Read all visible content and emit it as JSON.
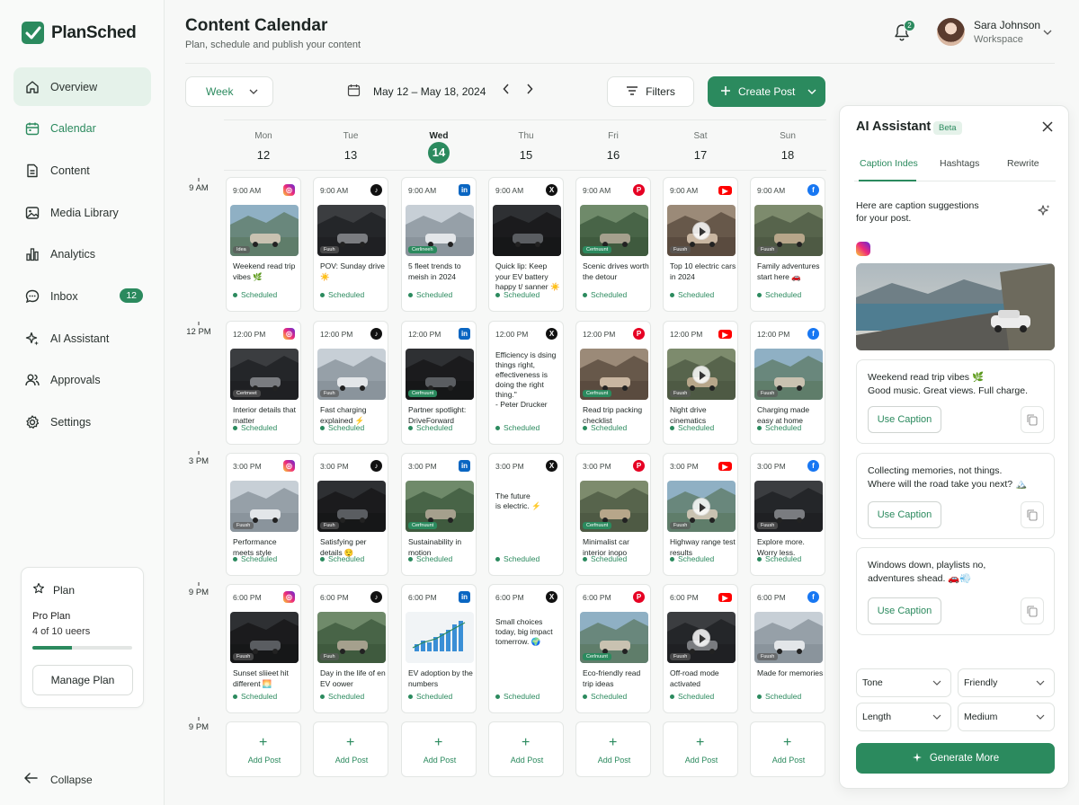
{
  "app": {
    "name": "PlanSched"
  },
  "nav": [
    {
      "label": "Overview",
      "icon": "home-icon"
    },
    {
      "label": "Calendar",
      "icon": "calendar-icon"
    },
    {
      "label": "Content",
      "icon": "document-icon"
    },
    {
      "label": "Media Library",
      "icon": "image-icon"
    },
    {
      "label": "Analytics",
      "icon": "bar-chart-icon"
    },
    {
      "label": "Inbox",
      "icon": "chat-icon",
      "badge": "12"
    },
    {
      "label": "AI Assistant",
      "icon": "sparkle-icon"
    },
    {
      "label": "Approvals",
      "icon": "users-icon"
    },
    {
      "label": "Settings",
      "icon": "gear-icon"
    }
  ],
  "plan": {
    "heading": "Plan",
    "name": "Pro Plan",
    "users": "4 of 10 ueers",
    "usage_fraction": 0.4,
    "button": "Manage Plan"
  },
  "collapse": "Collapse",
  "header": {
    "title": "Content Calendar",
    "subtitle": "Plan, schedule and publish your content",
    "notif_count": "2",
    "user_name": "Sara Johnson",
    "user_workspace": "Workspace"
  },
  "toolbar": {
    "view": "Week",
    "date_range": "May 12 – May 18, 2024",
    "filters": "Filters",
    "create": "Create Post"
  },
  "days": [
    {
      "name": "Mon",
      "num": "12"
    },
    {
      "name": "Tue",
      "num": "13"
    },
    {
      "name": "Wed",
      "num": "14",
      "today": true
    },
    {
      "name": "Thu",
      "num": "15"
    },
    {
      "name": "Fri",
      "num": "16"
    },
    {
      "name": "Sat",
      "num": "17"
    },
    {
      "name": "Sun",
      "num": "18"
    }
  ],
  "times": [
    "9 AM",
    "12 PM",
    "3 PM",
    "9 PM",
    "9 PM"
  ],
  "status_label": "Scheduled",
  "add_label": "Add Post",
  "slots": [
    {
      "time": "9:00 AM",
      "cards": [
        {
          "platform": "instagram",
          "title": "Weekend read trip vibes 🌿",
          "tag": "Idea",
          "tag_green": false
        },
        {
          "platform": "tiktok",
          "title": "POV: Sunday drive ☀️",
          "tag": "Fuuh",
          "tag_green": false
        },
        {
          "platform": "linkedin",
          "title": "5 fleet trends to meish in 2024",
          "tag": "Cerlineeh",
          "tag_green": true
        },
        {
          "platform": "x",
          "title": "Quick lip: Keep your EV battery happy t/ sanner ☀️",
          "tag": "",
          "tag_green": false
        },
        {
          "platform": "pinterest",
          "title": "Scenic drives worth the detour",
          "tag": "Certnuunt",
          "tag_green": true
        },
        {
          "platform": "youtube",
          "title": "Top 10 electric cars in 2024",
          "tag": "Fuush",
          "tag_green": false,
          "video": true
        },
        {
          "platform": "facebook",
          "title": "Family adventures start here 🚗",
          "tag": "Fuush",
          "tag_green": false
        }
      ]
    },
    {
      "time": "12:00 PM",
      "cards": [
        {
          "platform": "instagram",
          "title": "Interior details that matter",
          "tag": "Certmeet",
          "tag_green": false
        },
        {
          "platform": "tiktok",
          "title": "Fast charging explained ⚡",
          "tag": "Fuuh",
          "tag_green": false
        },
        {
          "platform": "linkedin",
          "title": "Partner spotlight: DriveForward",
          "tag": "Cerfnuunt",
          "tag_green": true
        },
        {
          "platform": "x",
          "quote": "Efficiency is dsing things right, effectiveness is doing the right thing.\"\n- Peter Drucker"
        },
        {
          "platform": "pinterest",
          "title": "Read trip packing checklist",
          "tag": "Cerfnuunt",
          "tag_green": true
        },
        {
          "platform": "youtube",
          "title": "Night drive cinematics",
          "tag": "Fuush",
          "tag_green": false,
          "video": true
        },
        {
          "platform": "facebook",
          "title": "Charging made easy at home",
          "tag": "Fuush",
          "tag_green": false
        }
      ]
    },
    {
      "time": "3:00 PM",
      "cards": [
        {
          "platform": "instagram",
          "title": "Performance meets style",
          "tag": "Fuush",
          "tag_green": false
        },
        {
          "platform": "tiktok",
          "title": "Satisfying per details 😌",
          "tag": "Fuuh",
          "tag_green": false
        },
        {
          "platform": "linkedin",
          "title": "Sustainability in motion",
          "tag": "Cerfnuunt",
          "tag_green": true
        },
        {
          "platform": "x",
          "quote": "The future\nis electric. ⚡"
        },
        {
          "platform": "pinterest",
          "title": "Minimalist car interior inopo",
          "tag": "Cerfnuunt",
          "tag_green": true
        },
        {
          "platform": "youtube",
          "title": "Highway range test results",
          "tag": "Fuush",
          "tag_green": false,
          "video": true
        },
        {
          "platform": "facebook",
          "title": "Explore more. Worry less.",
          "tag": "Fuush",
          "tag_green": false
        }
      ]
    },
    {
      "time": "6:00 PM",
      "cards": [
        {
          "platform": "instagram",
          "title": "Sunset sliieet hit different 🌅",
          "tag": "Fuush",
          "tag_green": false
        },
        {
          "platform": "tiktok",
          "title": "Day in the life of en EV oower",
          "tag": "Fuuh",
          "tag_green": false
        },
        {
          "platform": "linkedin",
          "title": "EV adoption by the numbers",
          "tag": "",
          "tag_green": false,
          "chart": true
        },
        {
          "platform": "x",
          "quote": "Small choices today, big impact tomerrow. 🌍"
        },
        {
          "platform": "pinterest",
          "title": "Eco-friendly read trip ideas",
          "tag": "Cerlnuunt",
          "tag_green": true
        },
        {
          "platform": "youtube",
          "title": "Off-road mode activated",
          "tag": "Fuush",
          "tag_green": false,
          "video": true
        },
        {
          "platform": "facebook",
          "title": "Made for memories",
          "tag": "Fuush",
          "tag_green": false
        }
      ]
    }
  ],
  "ai": {
    "title": "AI Assistant",
    "badge": "Beta",
    "tabs": [
      "Caption Indes",
      "Hashtags",
      "Rewrite"
    ],
    "intro": "Here are caption suggestions for your post.",
    "captions": [
      {
        "text": "Weekend read trip vibes 🌿\nGood music. Great views. Full charge."
      },
      {
        "text": "Collecting memories, not things.\nWhere will the road take you next? 🏔️"
      },
      {
        "text": "Windows down, playlists no,\nadventures shead. 🚗💨"
      }
    ],
    "use_caption": "Use Caption",
    "tone_label": "Tone",
    "tone_value": "Friendly",
    "length_label": "Length",
    "length_value": "Medium",
    "generate": "Generate More"
  }
}
